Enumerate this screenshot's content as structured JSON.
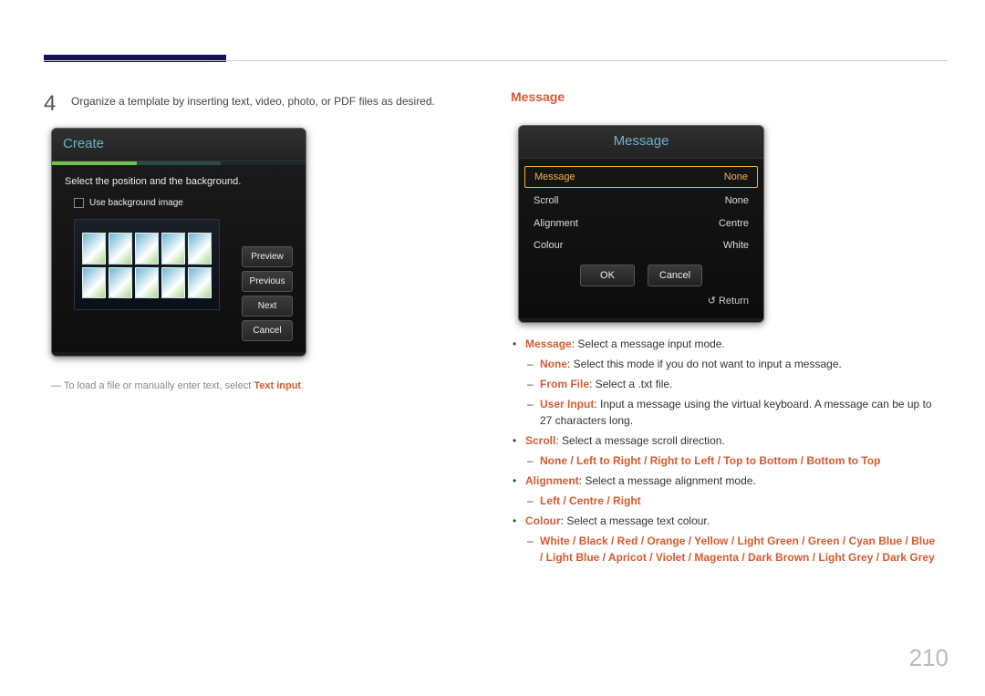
{
  "page_number": "210",
  "left": {
    "step_number": "4",
    "step_text": "Organize a template by inserting text, video, photo, or PDF files as desired.",
    "panel": {
      "title": "Create",
      "instruction": "Select the position and the background.",
      "checkbox_label": "Use background image",
      "buttons": {
        "preview": "Preview",
        "previous": "Previous",
        "next": "Next",
        "cancel": "Cancel"
      }
    },
    "note_prefix": "To load a file or manually enter text, select ",
    "note_highlight": "Text input",
    "note_suffix": "."
  },
  "right": {
    "section_title": "Message",
    "panel": {
      "title": "Message",
      "rows": {
        "message_label": "Message",
        "message_value": "None",
        "scroll_label": "Scroll",
        "scroll_value": "None",
        "alignment_label": "Alignment",
        "alignment_value": "Centre",
        "colour_label": "Colour",
        "colour_value": "White"
      },
      "ok": "OK",
      "cancel": "Cancel",
      "return": "Return"
    },
    "desc": {
      "message_label": "Message",
      "message_rest": ": Select a message input mode.",
      "none_label": "None",
      "none_rest": ": Select this mode if you do not want to input a message.",
      "fromfile_label": "From File",
      "fromfile_rest": ": Select a .txt file.",
      "userinput_label": "User Input",
      "userinput_rest": ": Input a message using the virtual keyboard. A message can be up to 27 characters long.",
      "scroll_label": "Scroll",
      "scroll_rest": ": Select a message scroll direction.",
      "scroll_options": "None / Left to Right / Right to Left / Top to Bottom / Bottom to Top",
      "alignment_label": "Alignment",
      "alignment_rest": ": Select a message alignment mode.",
      "alignment_options": "Left / Centre / Right",
      "colour_label": "Colour",
      "colour_rest": ": Select a message text colour.",
      "colour_options": "White / Black / Red / Orange / Yellow / Light Green / Green / Cyan Blue / Blue / Light Blue / Apricot / Violet / Magenta / Dark Brown / Light Grey / Dark Grey"
    }
  }
}
